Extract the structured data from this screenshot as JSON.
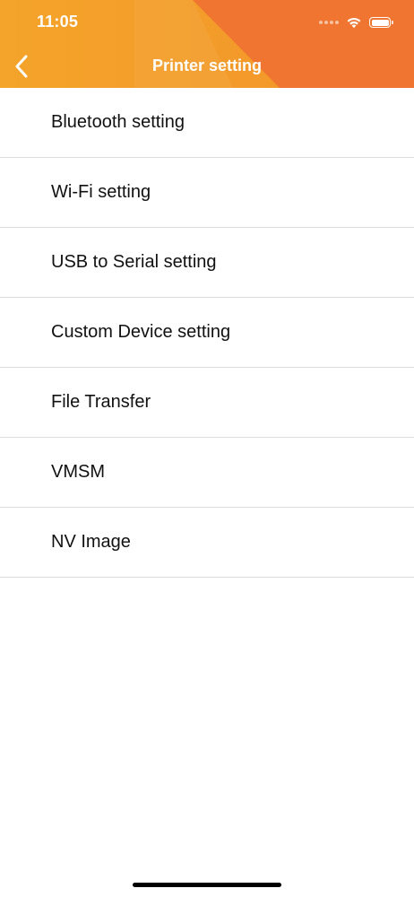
{
  "status_bar": {
    "time": "11:05",
    "icons": [
      "signal-dots-icon",
      "wifi-icon",
      "battery-icon"
    ]
  },
  "nav": {
    "back_icon": "chevron-left-icon",
    "title": "Printer setting"
  },
  "menu": {
    "items": [
      {
        "label": "Bluetooth setting"
      },
      {
        "label": "Wi-Fi setting"
      },
      {
        "label": "USB to Serial setting"
      },
      {
        "label": "Custom Device setting"
      },
      {
        "label": "File Transfer"
      },
      {
        "label": "VMSM"
      },
      {
        "label": "NV Image"
      }
    ]
  },
  "colors": {
    "header_orange_left": "#f4a42a",
    "header_orange_right": "#ef7530",
    "divider": "#dcdcdc",
    "text": "#111111"
  }
}
